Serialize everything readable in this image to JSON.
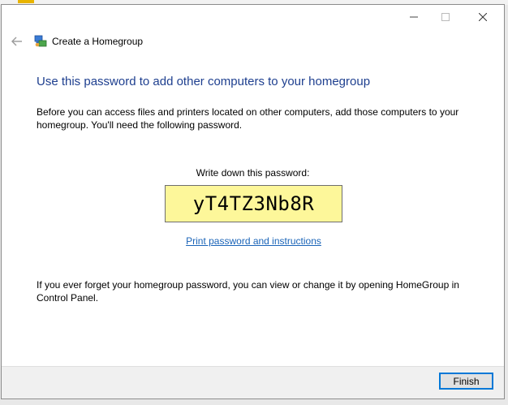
{
  "nav": {
    "back_icon": "arrow-left-icon",
    "homegroup_icon": "homegroup-icon",
    "title": "Create a Homegroup"
  },
  "window_controls": {
    "minimize_icon": "minimize-icon",
    "maximize_icon": "maximize-icon",
    "close_icon": "close-icon"
  },
  "content": {
    "heading": "Use this password to add other computers to your homegroup",
    "intro": "Before you can access files and printers located on other computers, add those computers to your homegroup. You'll need the following password.",
    "password_label": "Write down this password:",
    "password": "yT4TZ3Nb8R",
    "print_link": "Print password and instructions",
    "forget_note": "If you ever forget your homegroup password, you can view or change it by opening HomeGroup in Control Panel."
  },
  "footer": {
    "finish_label": "Finish"
  },
  "colors": {
    "heading": "#1e3f8f",
    "link": "#1a64b8",
    "password_bg": "#fdf79a",
    "button_border": "#0078d7"
  }
}
